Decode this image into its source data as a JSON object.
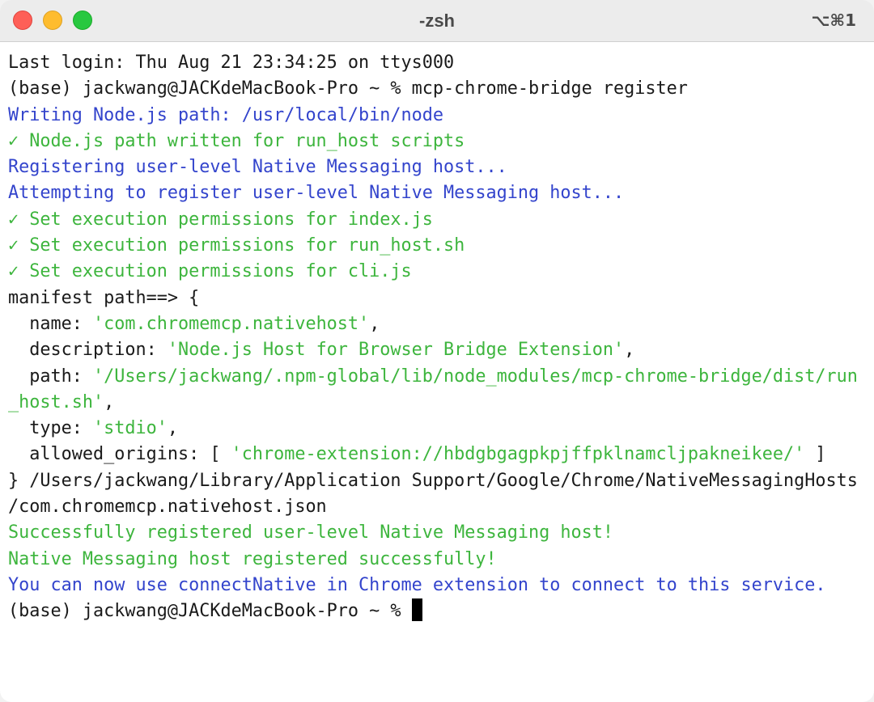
{
  "window": {
    "title": "-zsh",
    "shortcut": "⌥⌘1"
  },
  "terminal": {
    "lines": [
      {
        "text": "Last login: Thu Aug 21 23:34:25 on ttys000"
      },
      {
        "text": "(base) jackwang@JACKdeMacBook-Pro ~ % mcp-chrome-bridge register"
      },
      {
        "text": "Writing Node.js path: /usr/local/bin/node"
      },
      {
        "text": "✓ Node.js path written for run_host scripts"
      },
      {
        "text": "Registering user-level Native Messaging host..."
      },
      {
        "text": "Attempting to register user-level Native Messaging host..."
      },
      {
        "text": "✓ Set execution permissions for index.js"
      },
      {
        "text": "✓ Set execution permissions for run_host.sh"
      },
      {
        "text": "✓ Set execution permissions for cli.js"
      },
      {
        "text": "manifest path==> {"
      },
      {
        "key": "  name: ",
        "value": "'com.chromemcp.nativehost'",
        "suffix": ","
      },
      {
        "key": "  description: ",
        "value": "'Node.js Host for Browser Bridge Extension'",
        "suffix": ","
      },
      {
        "key": "  path: ",
        "value": "'/Users/jackwang/.npm-global/lib/node_modules/mcp-chrome-bridge/dist/run",
        "suffix": ""
      },
      {
        "value": "_host.sh'",
        "suffix": ","
      },
      {
        "key": "  type: ",
        "value": "'stdio'",
        "suffix": ","
      },
      {
        "key": "  allowed_origins: [ ",
        "value": "'chrome-extension://hbdgbgagpkpjffpklnamcljpakneikee/'",
        "suffix": " ]"
      },
      {
        "text": "} /Users/jackwang/Library/Application Support/Google/Chrome/NativeMessagingHosts"
      },
      {
        "text": "/com.chromemcp.nativehost.json"
      },
      {
        "text": "Successfully registered user-level Native Messaging host!"
      },
      {
        "text": "Native Messaging host registered successfully!"
      },
      {
        "text": "You can now use connectNative in Chrome extension to connect to this service."
      },
      {
        "text": "(base) jackwang@JACKdeMacBook-Pro ~ % "
      }
    ]
  },
  "colors": {
    "blue": "#3344cc",
    "green": "#3db53d",
    "default": "#1a1a1a"
  }
}
